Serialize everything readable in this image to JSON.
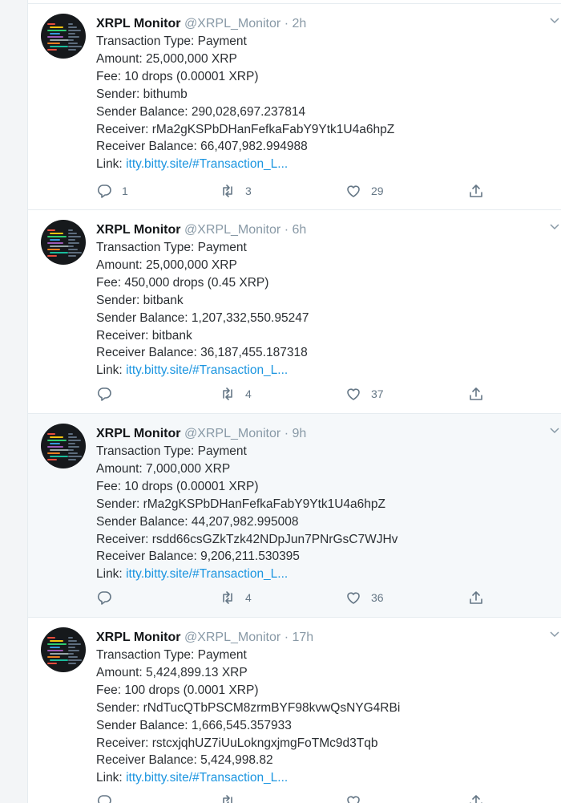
{
  "tweets": [
    {
      "name": "XRPL Monitor",
      "handle": "@XRPL_Monitor",
      "dot": "·",
      "time": "2h",
      "lines": [
        "Transaction Type: Payment",
        "Amount: 25,000,000 XRP",
        "Fee: 10 drops (0.00001 XRP)",
        "Sender: bithumb",
        "Sender Balance: 290,028,697.237814",
        "Receiver: rMa2gKSPbDHanFefkaFabY9Ytk1U4a6hpZ",
        "Receiver Balance: 66,407,982.994988"
      ],
      "link_label": "Link: ",
      "link_text": "itty.bitty.site/#Transaction_L...",
      "replies": "1",
      "retweets": "3",
      "likes": "29"
    },
    {
      "name": "XRPL Monitor",
      "handle": "@XRPL_Monitor",
      "dot": "·",
      "time": "6h",
      "lines": [
        "Transaction Type: Payment",
        "Amount: 25,000,000 XRP",
        "Fee: 450,000 drops (0.45 XRP)",
        "Sender: bitbank",
        "Sender Balance: 1,207,332,550.95247",
        "Receiver: bitbank",
        "Receiver Balance: 36,187,455.187318"
      ],
      "link_label": "Link: ",
      "link_text": "itty.bitty.site/#Transaction_L...",
      "replies": "",
      "retweets": "4",
      "likes": "37"
    },
    {
      "name": "XRPL Monitor",
      "handle": "@XRPL_Monitor",
      "dot": "·",
      "time": "9h",
      "lines": [
        "Transaction Type: Payment",
        "Amount: 7,000,000 XRP",
        "Fee: 10 drops (0.00001 XRP)",
        "Sender: rMa2gKSPbDHanFefkaFabY9Ytk1U4a6hpZ",
        "Sender Balance: 44,207,982.995008",
        "Receiver: rsdd66csGZkTzk42NDpJun7PNrGsC7WJHv",
        "Receiver Balance: 9,206,211.530395"
      ],
      "link_label": "Link: ",
      "link_text": "itty.bitty.site/#Transaction_L...",
      "replies": "",
      "retweets": "4",
      "likes": "36"
    },
    {
      "name": "XRPL Monitor",
      "handle": "@XRPL_Monitor",
      "dot": "·",
      "time": "17h",
      "lines": [
        "Transaction Type: Payment",
        "Amount: 5,424,899.13 XRP",
        "Fee: 100 drops (0.0001 XRP)",
        "Sender: rNdTucQTbPSCM8zrmBYF98kvwQsNYG4RBi",
        "Sender Balance: 1,666,545.357933",
        "Receiver: rstcxjqhUZ7iUuLokngxjmgFoTMc9d3Tqb",
        "Receiver Balance: 5,424,998.82"
      ],
      "link_label": "Link: ",
      "link_text": "itty.bitty.site/#Transaction_L...",
      "replies": "",
      "retweets": "",
      "likes": ""
    }
  ],
  "colors": {
    "link": "#1b95e0",
    "muted": "#8899a6",
    "highlight_bg": "#f5f8fa"
  }
}
